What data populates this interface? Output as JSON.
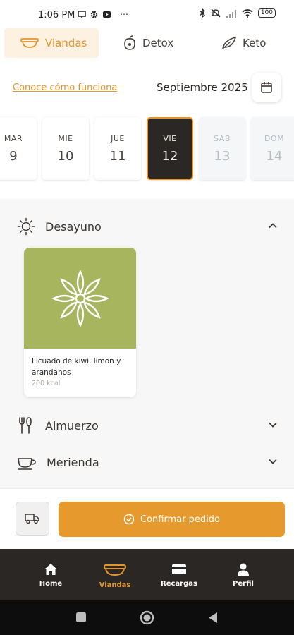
{
  "status_bar": {
    "time": "1:06 PM",
    "battery": "100"
  },
  "tabs": [
    {
      "label": "Viandas",
      "icon": "bowl-icon",
      "active": true
    },
    {
      "label": "Detox",
      "icon": "fruit-icon",
      "active": false
    },
    {
      "label": "Keto",
      "icon": "leaf-icon",
      "active": false
    }
  ],
  "how_it_works_link": "Conoce cómo funciona",
  "month_label": "Septiembre 2025",
  "days": [
    {
      "name": "MAR",
      "date": "9",
      "state": "normal"
    },
    {
      "name": "MIE",
      "date": "10",
      "state": "normal"
    },
    {
      "name": "JUE",
      "date": "11",
      "state": "normal"
    },
    {
      "name": "VIE",
      "date": "12",
      "state": "selected"
    },
    {
      "name": "SAB",
      "date": "13",
      "state": "disabled"
    },
    {
      "name": "DOM",
      "date": "14",
      "state": "disabled"
    }
  ],
  "meals": {
    "breakfast": {
      "label": "Desayuno",
      "expanded": true,
      "product": {
        "name": "Licuado de kiwi, limon y arandanos",
        "kcal": "200 kcal"
      }
    },
    "lunch": {
      "label": "Almuerzo",
      "expanded": false
    },
    "snack": {
      "label": "Merienda",
      "expanded": false
    }
  },
  "confirm_button": "Confirmar pedido",
  "bottom_nav": [
    {
      "label": "Home",
      "icon": "home-icon",
      "active": false
    },
    {
      "label": "Viandas",
      "icon": "bowl-icon",
      "active": true
    },
    {
      "label": "Recargas",
      "icon": "card-icon",
      "active": false
    },
    {
      "label": "Perfil",
      "icon": "user-icon",
      "active": false
    }
  ],
  "colors": {
    "accent": "#e3952b",
    "dark": "#2b2724",
    "product_bg": "#a6b55e"
  }
}
